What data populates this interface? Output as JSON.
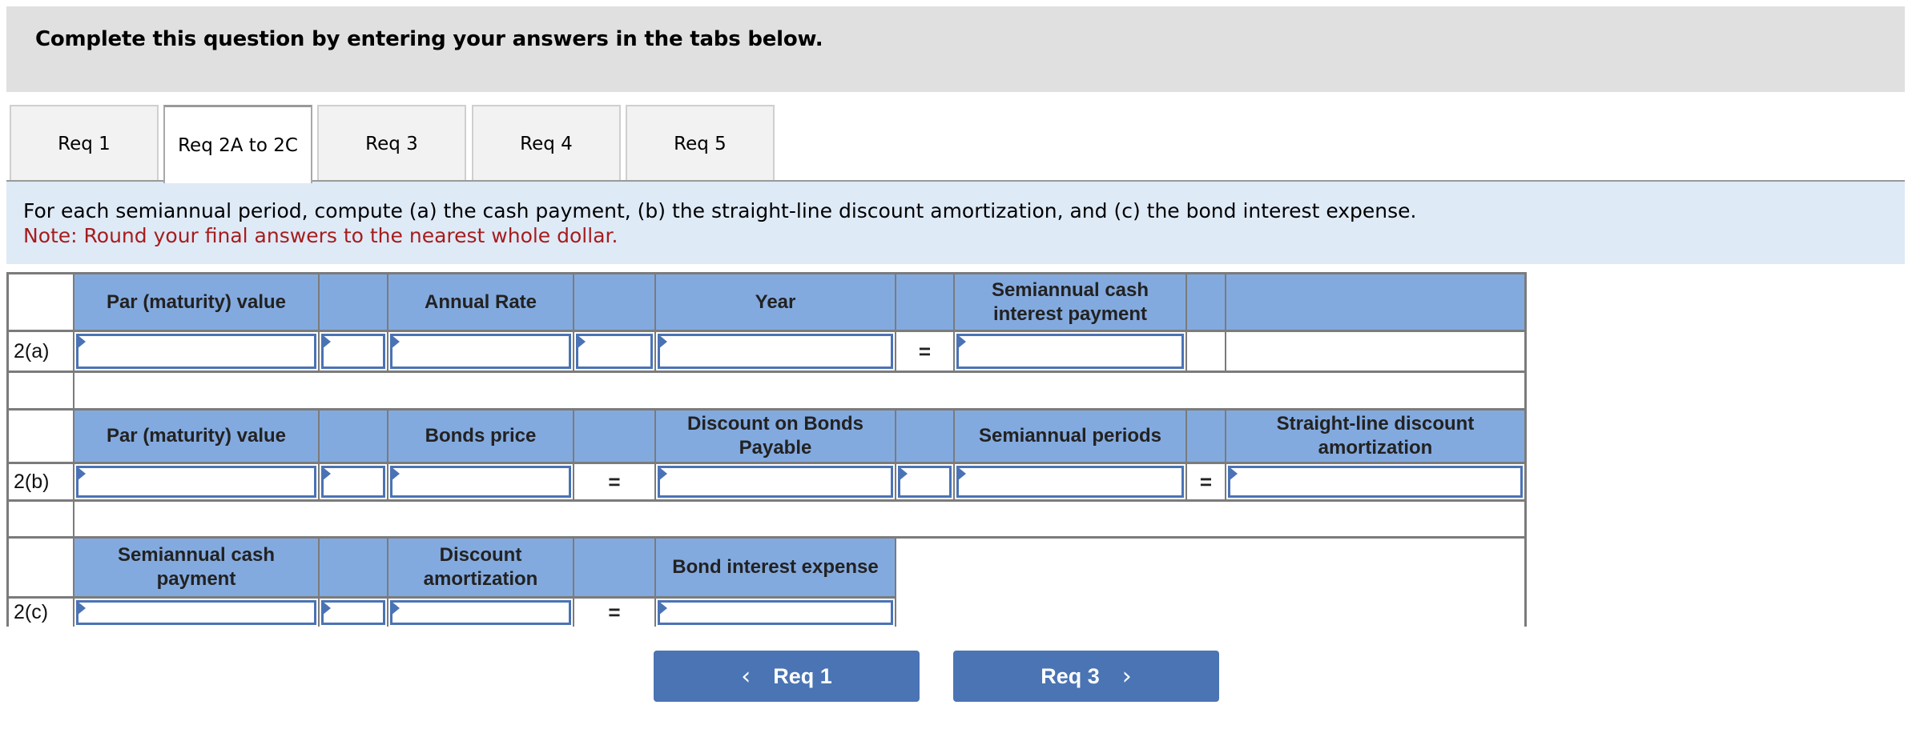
{
  "header": {
    "title": "Complete this question by entering your answers in the tabs below."
  },
  "tabs": [
    {
      "label": "Req 1",
      "active": false
    },
    {
      "label": "Req 2A to 2C",
      "active": true
    },
    {
      "label": "Req 3",
      "active": false
    },
    {
      "label": "Req 4",
      "active": false
    },
    {
      "label": "Req 5",
      "active": false
    }
  ],
  "instructions": {
    "text": "For each semiannual period, compute (a) the cash payment, (b) the straight-line discount amortization, and (c) the bond interest expense.",
    "note": "Note: Round your final answers to the nearest whole dollar."
  },
  "table": {
    "part_a": {
      "row_label": "2(a)",
      "headers": [
        "Par (maturity) value",
        "",
        "Annual Rate",
        "",
        "Year",
        "",
        "Semiannual cash interest payment",
        "",
        ""
      ],
      "inputs": {
        "par_value": "",
        "operator_1": "",
        "annual_rate": "",
        "operator_2": "",
        "year": "",
        "semiannual_cash_interest_payment": ""
      },
      "equals": "="
    },
    "part_b": {
      "row_label": "2(b)",
      "headers": [
        "Par (maturity) value",
        "",
        "Bonds price",
        "",
        "Discount on Bonds Payable",
        "",
        "Semiannual periods",
        "",
        "Straight-line discount amortization"
      ],
      "inputs": {
        "par_value": "",
        "operator_1": "",
        "bonds_price": "",
        "discount_on_bonds_payable": "",
        "operator_2": "",
        "semiannual_periods": "",
        "straight_line_discount_amortization": ""
      },
      "equals": "="
    },
    "part_c": {
      "row_label": "2(c)",
      "headers": [
        "Semiannual cash payment",
        "",
        "Discount amortization",
        "",
        "Bond interest expense"
      ],
      "inputs": {
        "semiannual_cash_payment": "",
        "operator_1": "",
        "discount_amortization": "",
        "bond_interest_expense": ""
      },
      "equals": "="
    }
  },
  "navigation": {
    "prev": {
      "label": "Req 1",
      "icon": "chevron-left-icon",
      "glyph": "‹"
    },
    "next": {
      "label": "Req 3",
      "icon": "chevron-right-icon",
      "glyph": "›"
    }
  },
  "colors": {
    "header_band": "#e0e0e0",
    "instruction_band": "#dfeaf7",
    "note_text": "#a51d1d",
    "table_header": "#83aadf",
    "input_border": "#4a73b5",
    "nav_button": "#4a74b3"
  }
}
